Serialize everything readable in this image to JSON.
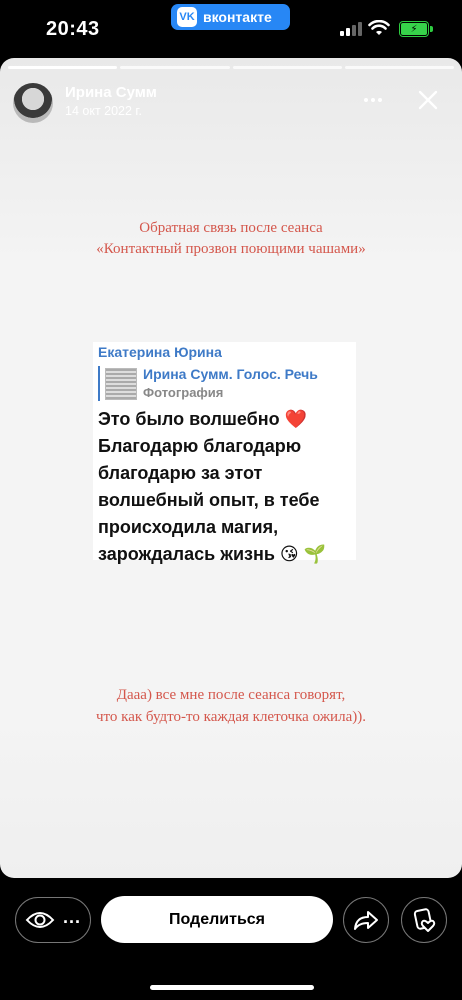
{
  "status_bar": {
    "time": "20:43",
    "app_pill": "вконтакте",
    "app_logo": "VK",
    "colors": {
      "pill": "#2787f5",
      "battery": "#37d34a"
    }
  },
  "story": {
    "author": "Ирина Сумм",
    "date": "14 окт 2022 г.",
    "progress_segments": 4,
    "active_segment": 1,
    "caption_top": [
      "Обратная связь после сеанса",
      "«Контактный прозвон поющими чашами»"
    ],
    "message": {
      "sender": "Екатерина Юрина",
      "quote_author": "Ирина Сумм. Голос. Речь",
      "quote_type": "Фотография",
      "text_lines": [
        "Это было волшебно ❤️",
        "Благодарю благодарю",
        "благодарю за этот",
        "волшебный опыт, в тебе",
        "происходила магия,",
        "зарождалась жизнь 😘 🌱"
      ]
    },
    "caption_bottom": [
      "Дааа) все мне после сеанса говорят,",
      "что как будто-то каждая клеточка ожила))."
    ],
    "colors": {
      "caption": "#d4574c",
      "link": "#3e7ac7"
    }
  },
  "bottom_bar": {
    "views_dots": "...",
    "share_label": "Поделиться",
    "icons": [
      "eye-icon",
      "forward-icon",
      "like-icon"
    ]
  }
}
